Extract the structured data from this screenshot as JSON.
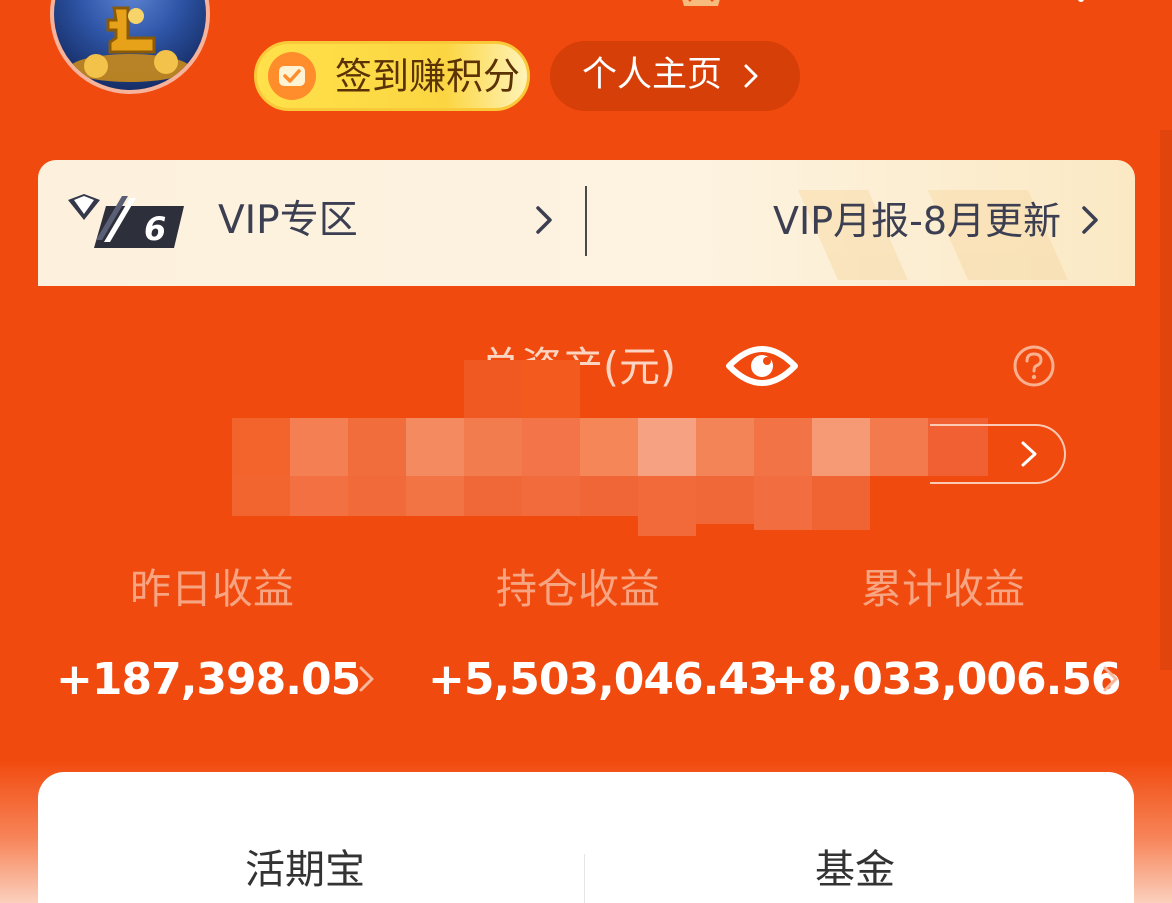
{
  "header": {
    "checkin_label": "签到赚积分",
    "profile_label": "个人主页"
  },
  "vip": {
    "zone_label": "VIP专区",
    "level": "6",
    "report_label": "VIP月报-8月更新"
  },
  "assets": {
    "title": "总资产(元)",
    "amount": "",
    "detail_label": ""
  },
  "stats": [
    {
      "label": "昨日收益",
      "value": "+187,398.05"
    },
    {
      "label": "持仓收益",
      "value": "+5,503,046.43"
    },
    {
      "label": "累计收益",
      "value": "+8,033,006.56"
    }
  ],
  "tabs": [
    {
      "label": "活期宝"
    },
    {
      "label": "基金"
    }
  ],
  "icons": {
    "checkin": "checkin-check-icon",
    "eye": "eye-icon",
    "help": "question-circle-icon",
    "chevron": "chevron-right-icon",
    "vip_badge": "diamond-vip-badge-icon"
  },
  "colors": {
    "brand_orange": "#f14a0e",
    "checkin_yellow": "#ffe14a",
    "vip_cream": "#fdf1dd"
  }
}
